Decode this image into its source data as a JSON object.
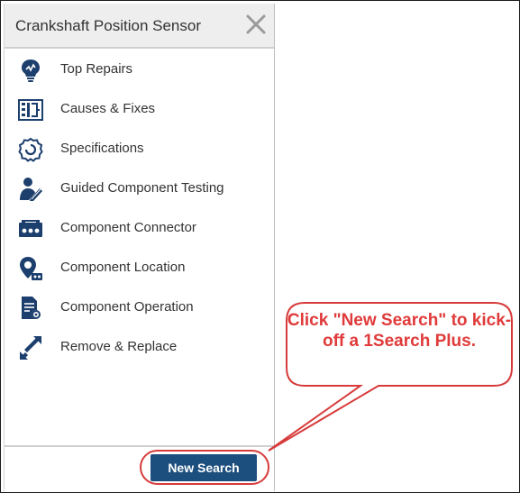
{
  "panel": {
    "title": "Crankshaft Position Sensor",
    "items": [
      {
        "label": "Top Repairs",
        "icon": "lightbulb-icon"
      },
      {
        "label": "Causes & Fixes",
        "icon": "causes-fixes-icon"
      },
      {
        "label": "Specifications",
        "icon": "specifications-icon"
      },
      {
        "label": "Guided Component Testing",
        "icon": "guided-testing-icon"
      },
      {
        "label": "Component Connector",
        "icon": "connector-icon"
      },
      {
        "label": "Component Location",
        "icon": "location-icon"
      },
      {
        "label": "Component Operation",
        "icon": "operation-icon"
      },
      {
        "label": "Remove & Replace",
        "icon": "remove-replace-icon"
      }
    ],
    "close_icon": "close-icon"
  },
  "footer": {
    "new_search_label": "New Search"
  },
  "callout": {
    "text": "Click \"New Search\" to kick-off a 1Search Plus."
  },
  "colors": {
    "icon_navy": "#1d3f6e",
    "button_blue": "#1d4f7e",
    "callout_red": "#e03a3a"
  }
}
